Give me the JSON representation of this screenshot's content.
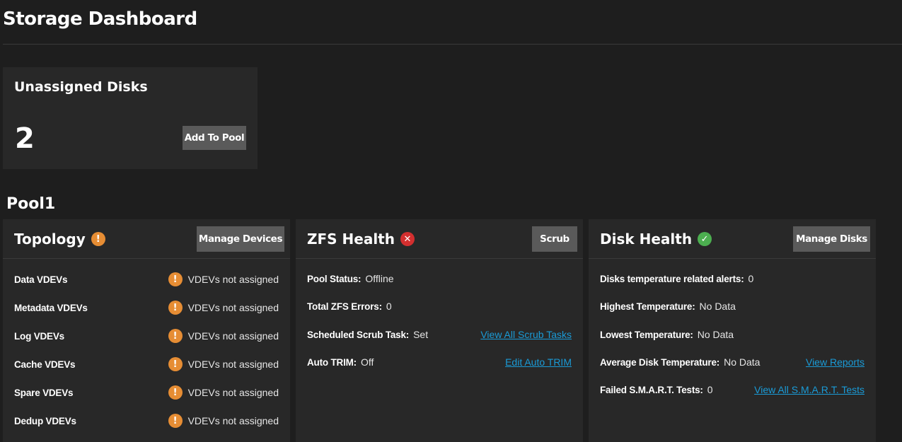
{
  "page": {
    "title": "Storage Dashboard"
  },
  "unassigned": {
    "title": "Unassigned Disks",
    "count": "2",
    "button": "Add To Pool"
  },
  "pool": {
    "name": "Pool1",
    "topology": {
      "title": "Topology",
      "status_icon": "warning-icon",
      "button": "Manage Devices",
      "rows": [
        {
          "label": "Data VDEVs",
          "value": "VDEVs not assigned"
        },
        {
          "label": "Metadata VDEVs",
          "value": "VDEVs not assigned"
        },
        {
          "label": "Log VDEVs",
          "value": "VDEVs not assigned"
        },
        {
          "label": "Cache VDEVs",
          "value": "VDEVs not assigned"
        },
        {
          "label": "Spare VDEVs",
          "value": "VDEVs not assigned"
        },
        {
          "label": "Dedup VDEVs",
          "value": "VDEVs not assigned"
        }
      ]
    },
    "zfs_health": {
      "title": "ZFS Health",
      "status_icon": "error-icon",
      "button": "Scrub",
      "rows": [
        {
          "label": "Pool Status:",
          "value": "Offline",
          "link": ""
        },
        {
          "label": "Total ZFS Errors:",
          "value": "0",
          "link": ""
        },
        {
          "label": "Scheduled Scrub Task:",
          "value": "Set",
          "link": "View All Scrub Tasks"
        },
        {
          "label": "Auto TRIM:",
          "value": "Off",
          "link": "Edit Auto TRIM"
        }
      ]
    },
    "disk_health": {
      "title": "Disk Health",
      "status_icon": "check-icon",
      "button": "Manage Disks",
      "rows": [
        {
          "label": "Disks temperature related alerts:",
          "value": "0",
          "link": ""
        },
        {
          "label": "Highest Temperature:",
          "value": "No Data",
          "link": ""
        },
        {
          "label": "Lowest Temperature:",
          "value": "No Data",
          "link": ""
        },
        {
          "label": "Average Disk Temperature:",
          "value": "No Data",
          "link": "View Reports"
        },
        {
          "label": "Failed S.M.A.R.T. Tests:",
          "value": "0",
          "link": "View All S.M.A.R.T. Tests"
        }
      ]
    }
  },
  "colors": {
    "background": "#1e1e1e",
    "card": "#282828",
    "button": "#5a5a5a",
    "warning": "#e68d34",
    "error": "#d32f2f",
    "ok": "#4caf50",
    "link": "#1a9bd7"
  }
}
